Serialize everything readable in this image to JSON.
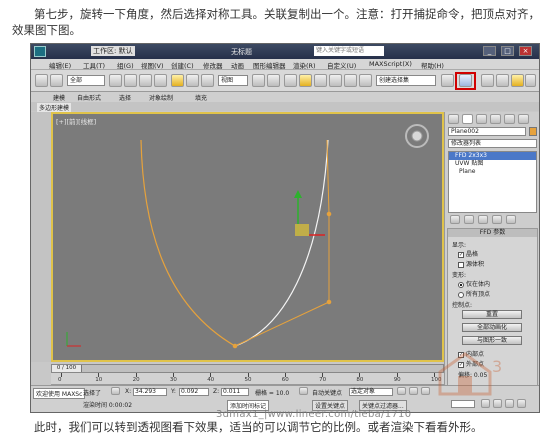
{
  "article": {
    "caption_top": "第七步，旋转一下角度，然后选择对称工具。关联复制出一个。注意：打开捕捉命令，把顶点对齐，效果图下图。",
    "caption_bottom": "此时，我们可以转到透视图看下效果，适当的可以调节它的比例。或者渲染下看看外形。",
    "watermark": "3dmax1_|www.lineer.com/tieba/1710"
  },
  "window": {
    "title": "无标题",
    "workspace": "工作区: 默认",
    "search_placeholder": "键入关键字或短语",
    "buttons": [
      "_",
      "□",
      "×"
    ]
  },
  "menubar": {
    "items": [
      "编辑(E)",
      "工具(T)",
      "组(G)",
      "视图(V)",
      "创建(C)",
      "修改器",
      "动画",
      "图形编辑器",
      "渲染(R)",
      "自定义(U)",
      "MAXScript(X)",
      "帮助(H)"
    ]
  },
  "toolbar": {
    "selection_filter": "全部",
    "ref_coord": "视图",
    "named_selection": "创建选择集"
  },
  "ribbon": {
    "tabs": [
      "建模",
      "自由形式",
      "选择",
      "对象绘制",
      "填充"
    ],
    "subtab": "多边形建模"
  },
  "viewport": {
    "label": "[+][前][线框]"
  },
  "command_panel": {
    "object_name": "Plane002",
    "modifier_list_label": "修改器列表",
    "stack": [
      "FFD 2x3x3",
      "UVW 贴图",
      "Plane"
    ],
    "rollout_title": "FFD 参数",
    "display_group": "显示:",
    "display_options": [
      {
        "label": "晶格",
        "checked": true
      },
      {
        "label": "源体积",
        "checked": false
      }
    ],
    "deform_group": "变形:",
    "deform_options": [
      {
        "label": "仅在体内",
        "selected": true
      },
      {
        "label": "所有顶点",
        "selected": false
      }
    ],
    "control_group": "控制点:",
    "control_buttons": [
      "重置",
      "全部动画化",
      "与图形一致"
    ],
    "control_checks": [
      {
        "label": "内部点",
        "checked": true
      },
      {
        "label": "外部点",
        "checked": true
      }
    ],
    "offset_label": "偏移: 0.05"
  },
  "timeline": {
    "frame_display": "0 / 100",
    "ticks": [
      "0",
      "10",
      "20",
      "30",
      "40",
      "50",
      "60",
      "70",
      "80",
      "90",
      "100"
    ]
  },
  "status": {
    "selection": "选择了",
    "x_label": "X:",
    "x_value": "34.293",
    "y_label": "Y:",
    "y_value": "0.092",
    "z_label": "Z:",
    "z_value": "0.011",
    "grid": "栅格 = 10.0",
    "auto_key": "自动关键点",
    "selected_set": "选定对象",
    "set_key": "设置关键点",
    "key_filter": "关键点过滤器...",
    "welcome": "欢迎使用 MAXSc",
    "render_time": "渲染时间 0:00:02",
    "add_time_tag": "添加时间标记"
  },
  "colors": {
    "viewport_bg": "#7b7b7b",
    "curve_orange": "#e6a23c",
    "curve_white": "#f4f4f4",
    "highlight_red": "#d00000",
    "active_border": "#e0c34a"
  }
}
